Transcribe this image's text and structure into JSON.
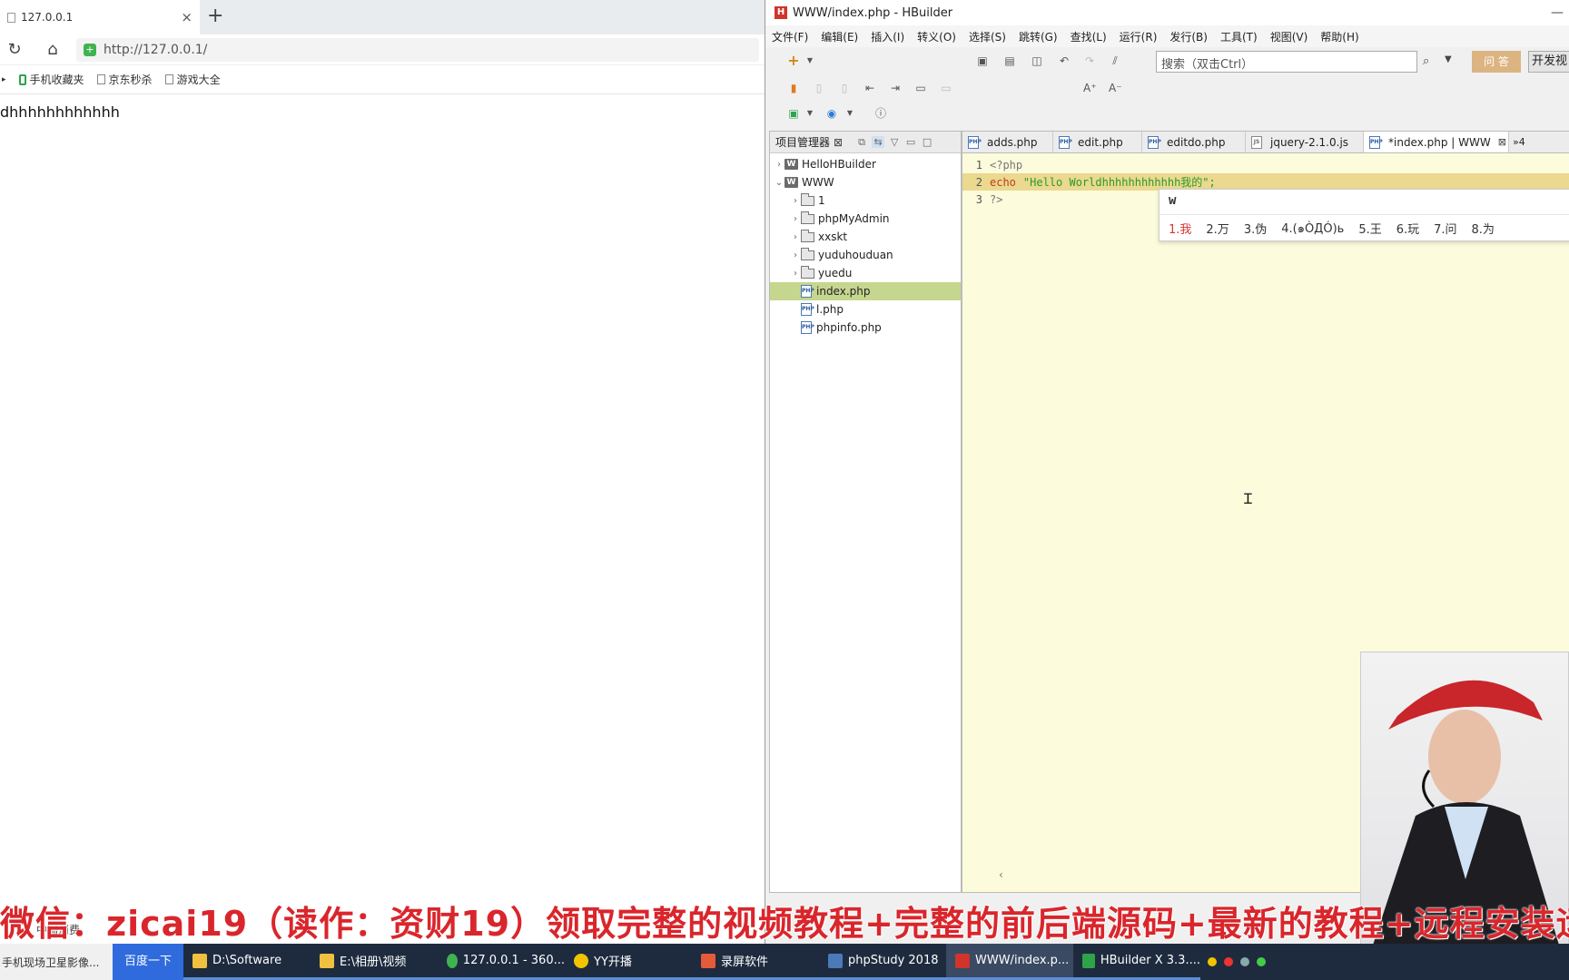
{
  "browser": {
    "tab_title": "127.0.0.1",
    "tab_close": "×",
    "new_tab": "+",
    "url": "http://127.0.0.1/",
    "bookmarks": [
      "手机收藏夹",
      "京东秒杀",
      "游戏大全"
    ],
    "page_text": "dhhhhhhhhhhhh"
  },
  "hbuilder": {
    "window_title": "WWW/index.php - HBuilder",
    "menu": [
      "文件(F)",
      "编辑(E)",
      "插入(I)",
      "转义(O)",
      "选择(S)",
      "跳转(G)",
      "查找(L)",
      "运行(R)",
      "发行(B)",
      "工具(T)",
      "视图(V)",
      "帮助(H)"
    ],
    "search_placeholder": "搜索（双击Ctrl）",
    "ask_label": "问 答",
    "dev_view_label": "开发视",
    "project_panel": {
      "title": "项目管理器",
      "items": [
        {
          "label": "HelloHBuilder",
          "type": "project",
          "level": 0,
          "expanded": false
        },
        {
          "label": "WWW",
          "type": "project",
          "level": 0,
          "expanded": true
        },
        {
          "label": "1",
          "type": "folder",
          "level": 1,
          "expanded": false
        },
        {
          "label": "phpMyAdmin",
          "type": "folder",
          "level": 1,
          "expanded": false
        },
        {
          "label": "xxskt",
          "type": "folder",
          "level": 1,
          "expanded": false
        },
        {
          "label": "yuduhouduan",
          "type": "folder",
          "level": 1,
          "expanded": false
        },
        {
          "label": "yuedu",
          "type": "folder",
          "level": 1,
          "expanded": false
        },
        {
          "label": "index.php",
          "type": "file",
          "level": 1,
          "selected": true
        },
        {
          "label": "l.php",
          "type": "file",
          "level": 1
        },
        {
          "label": "phpinfo.php",
          "type": "file",
          "level": 1
        }
      ]
    },
    "editor_tabs": [
      {
        "label": "adds.php",
        "active": false
      },
      {
        "label": "edit.php",
        "active": false
      },
      {
        "label": "editdo.php",
        "active": false
      },
      {
        "label": "jquery-2.1.0.js",
        "active": false
      },
      {
        "label": "*index.php | WWW",
        "active": true
      }
    ],
    "tabs_overflow": "»4",
    "code_lines": [
      {
        "num": "1",
        "text": "<?php"
      },
      {
        "num": "2",
        "kw": "echo",
        "str": "\"Hello Worldhhhhhhhhhhhh我的\";"
      },
      {
        "num": "3",
        "text": "?>"
      }
    ],
    "ime": {
      "input": "w",
      "candidates": [
        "1.我",
        "2.万",
        "3.伪",
        "4.(๑ÒДÓ)ь",
        "5.王",
        "6.玩",
        "7.问",
        "8.为"
      ]
    }
  },
  "watermark": "微信：zicai19（读作：资财19）领取完整的视频教程+完整的前后端源码+最新的教程+远程安装运",
  "taskbar": {
    "search_text": "手机现场卫星影像...",
    "search_button": "百度一下",
    "tasks": [
      {
        "label": "D:\\Software",
        "color": "#f0c040"
      },
      {
        "label": "E:\\相册\\视频",
        "color": "#f0c040"
      },
      {
        "label": "127.0.0.1 - 360...",
        "color": "#3fb34f"
      },
      {
        "label": "YY开播",
        "color": "#f2c400"
      },
      {
        "label": "录屏软件",
        "color": "#e55a3a"
      },
      {
        "label": "phpStudy 2018",
        "color": "#4a7ab8"
      },
      {
        "label": "WWW/index.p...",
        "color": "#d0342c",
        "active": true
      },
      {
        "label": "HBuilder X 3.3....",
        "color": "#2ea34a"
      }
    ]
  }
}
